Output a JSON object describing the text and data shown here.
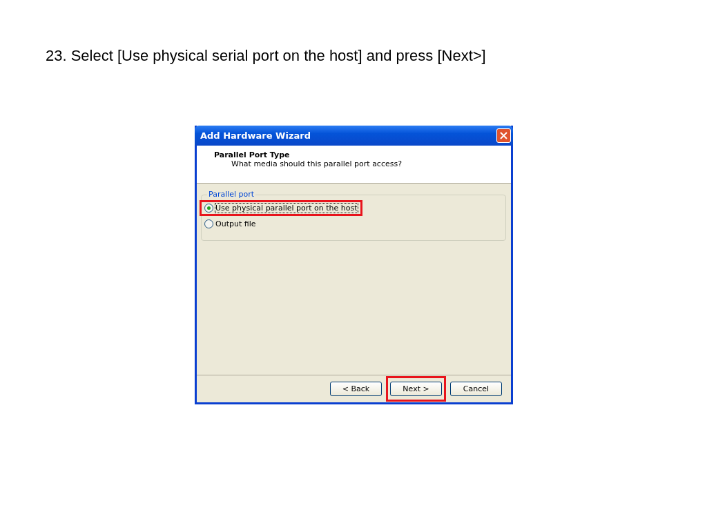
{
  "instruction": "23. Select [Use physical serial port on the host] and press [Next>]",
  "window": {
    "title": "Add Hardware Wizard"
  },
  "header": {
    "title": "Parallel Port Type",
    "subtitle": "What media should this parallel port access?"
  },
  "group": {
    "label": "Parallel port",
    "options": [
      {
        "label": "Use physical parallel port on the host",
        "selected": true,
        "highlighted": true
      },
      {
        "label": "Output file",
        "selected": false,
        "highlighted": false
      }
    ]
  },
  "buttons": [
    {
      "label": "< Back",
      "highlighted": false
    },
    {
      "label": "Next >",
      "highlighted": true
    },
    {
      "label": "Cancel",
      "highlighted": false
    }
  ]
}
